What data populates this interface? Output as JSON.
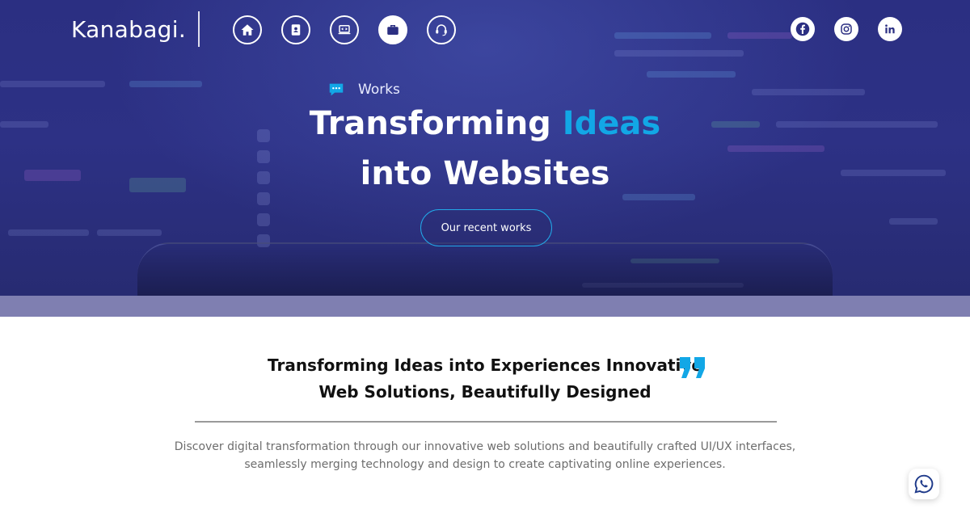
{
  "brand": {
    "logo_text": "Kanabagi."
  },
  "nav": {
    "items": [
      {
        "icon": "home-icon",
        "label": "Home",
        "active": false
      },
      {
        "icon": "contact-book-icon",
        "label": "About",
        "active": false
      },
      {
        "icon": "laptop-code-icon",
        "label": "Services",
        "active": false
      },
      {
        "icon": "briefcase-icon",
        "label": "Works",
        "active": true
      },
      {
        "icon": "headset-icon",
        "label": "Contact",
        "active": false
      }
    ]
  },
  "social": [
    {
      "icon": "facebook-icon"
    },
    {
      "icon": "instagram-icon"
    },
    {
      "icon": "linkedin-icon"
    }
  ],
  "hero": {
    "tag": "Works",
    "headline_part1": "Transforming ",
    "headline_accent": "Ideas",
    "headline_line2": "into Websites",
    "cta_label": "Our recent works"
  },
  "content": {
    "title_line1": "Transforming Ideas into Experiences Innovative",
    "title_line2": "Web Solutions, Beautifully Designed",
    "description_line1": "Discover digital transformation through our innovative web solutions and beautifully crafted UI/UX interfaces,",
    "description_line2": "seamlessly merging technology and design to create captivating online experiences."
  },
  "colors": {
    "accent": "#12a7e6",
    "hero_bg": "#2b2f82",
    "whatsapp": "#1f3a8a"
  }
}
